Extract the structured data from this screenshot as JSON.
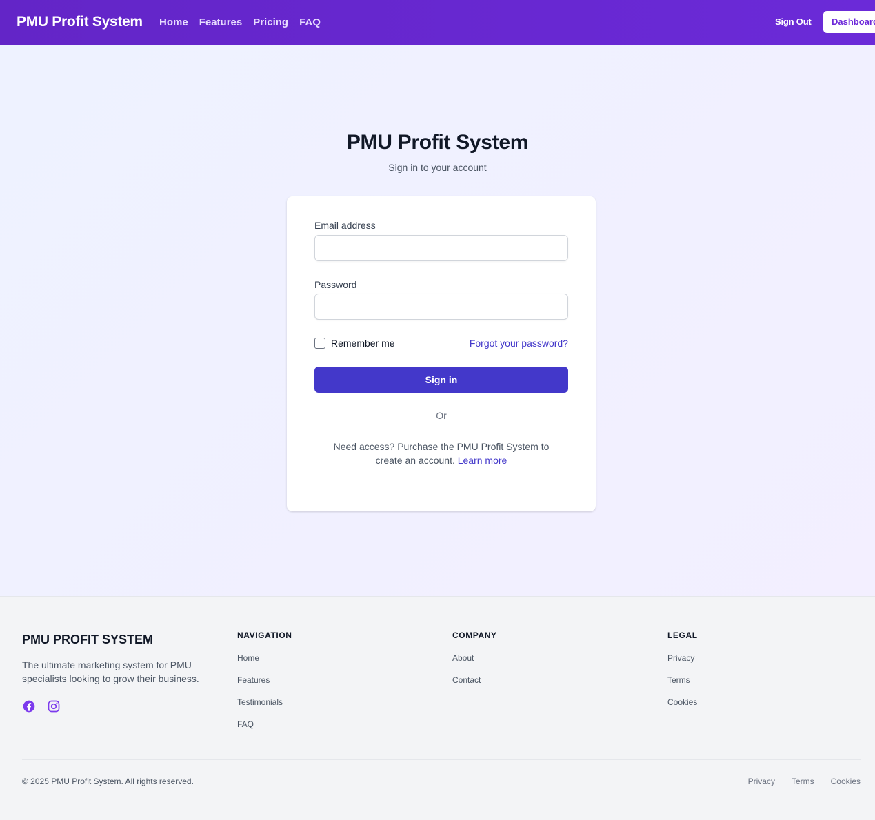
{
  "header": {
    "brand": "PMU Profit System",
    "nav": [
      "Home",
      "Features",
      "Pricing",
      "FAQ"
    ],
    "sign_out": "Sign Out",
    "dashboard": "Dashboard"
  },
  "login": {
    "title": "PMU Profit System",
    "subtitle": "Sign in to your account",
    "email_label": "Email address",
    "email_value": "",
    "password_label": "Password",
    "password_value": "",
    "remember_label": "Remember me",
    "remember_checked": false,
    "forgot_link": "Forgot your password?",
    "submit_label": "Sign in",
    "divider_text": "Or",
    "access_text": "Need access? Purchase the PMU Profit System to create an account.",
    "learn_more": "Learn more"
  },
  "footer": {
    "brand": "PMU PROFIT SYSTEM",
    "description": "The ultimate marketing system for PMU specialists looking to grow their business.",
    "social_icons": [
      "facebook-icon",
      "instagram-icon"
    ],
    "accent_color": "#7c3aed",
    "columns": [
      {
        "heading": "NAVIGATION",
        "links": [
          "Home",
          "Features",
          "Testimonials",
          "FAQ"
        ]
      },
      {
        "heading": "COMPANY",
        "links": [
          "About",
          "Contact"
        ]
      },
      {
        "heading": "LEGAL",
        "links": [
          "Privacy",
          "Terms",
          "Cookies"
        ]
      }
    ],
    "copyright": "© 2025 PMU Profit System. All rights reserved.",
    "bottom_links": [
      "Privacy",
      "Terms",
      "Cookies"
    ]
  },
  "colors": {
    "header_gradient_start": "#6325c7",
    "header_gradient_end": "#6b2ad8",
    "primary_button": "#4338ca",
    "link": "#4338ca"
  }
}
